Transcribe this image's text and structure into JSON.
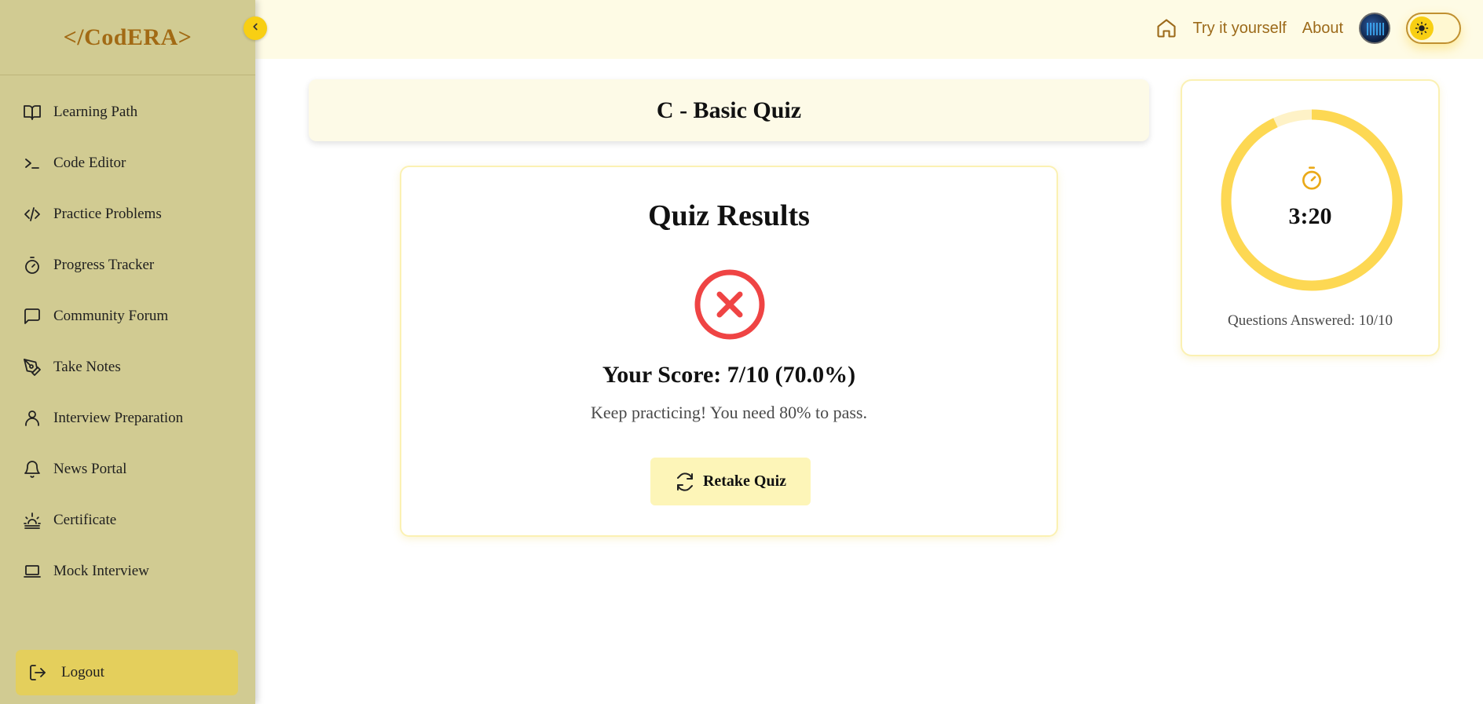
{
  "sidebar": {
    "logo": "</CodERA>",
    "items": [
      {
        "label": "Learning Path",
        "icon": "book-open-icon"
      },
      {
        "label": "Code Editor",
        "icon": "terminal-icon"
      },
      {
        "label": "Practice Problems",
        "icon": "code-icon"
      },
      {
        "label": "Progress Tracker",
        "icon": "stopwatch-icon"
      },
      {
        "label": "Community Forum",
        "icon": "message-square-icon"
      },
      {
        "label": "Take Notes",
        "icon": "pen-tool-icon"
      },
      {
        "label": "Interview Preparation",
        "icon": "user-icon"
      },
      {
        "label": "News Portal",
        "icon": "bell-icon"
      },
      {
        "label": "Certificate",
        "icon": "sunrise-icon"
      },
      {
        "label": "Mock Interview",
        "icon": "laptop-icon"
      }
    ],
    "logout_label": "Logout"
  },
  "header": {
    "try_label": "Try it yourself",
    "about_label": "About"
  },
  "quiz": {
    "title": "C - Basic Quiz",
    "results_title": "Quiz Results",
    "score_text": "Your Score: 7/10 (70.0%)",
    "score": 7,
    "total": 10,
    "message": "Keep practicing! You need 80% to pass.",
    "retake_label": "Retake Quiz"
  },
  "timer": {
    "value": "3:20",
    "progress_fraction": 0.93,
    "answered_text": "Questions Answered: 10/10"
  },
  "colors": {
    "sidebar_bg": "#d1cb92",
    "accent_yellow": "#f8cf13",
    "ring_fill": "#fdd853",
    "ring_track": "#fef2c7",
    "fail_red": "#ef4444",
    "brand_brown": "#a26a14"
  }
}
